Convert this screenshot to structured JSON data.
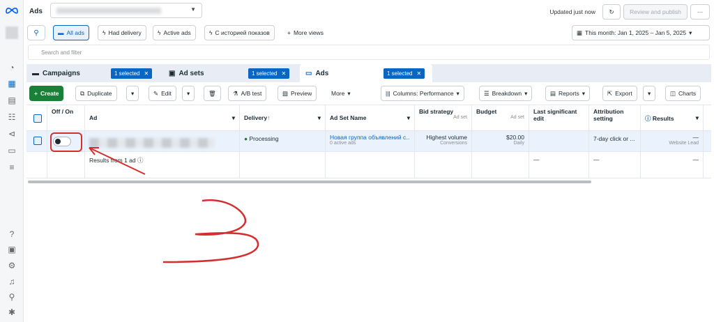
{
  "header": {
    "title": "Ads",
    "updated": "Updated just now",
    "review_label": "Review and publish",
    "more_label": "···"
  },
  "filters": {
    "all_ads": "All ads",
    "had_delivery": "Had delivery",
    "active_ads": "Active ads",
    "impressions_history": "С историей показов",
    "more_views": "More views",
    "date_range": "This month: Jan 1, 2025 – Jan 5, 2025"
  },
  "search": {
    "placeholder": "Search and filter"
  },
  "tabs": {
    "campaigns": "Campaigns",
    "ad_sets": "Ad sets",
    "ads": "Ads",
    "selected": "1 selected"
  },
  "toolbar": {
    "create": "Create",
    "duplicate": "Duplicate",
    "edit": "Edit",
    "ab_test": "A/B test",
    "preview": "Preview",
    "more": "More",
    "columns": "Columns: Performance",
    "breakdown": "Breakdown",
    "reports": "Reports",
    "export": "Export",
    "charts": "Charts"
  },
  "table": {
    "headers": {
      "off_on": "Off / On",
      "ad": "Ad",
      "delivery": "Delivery",
      "ad_set_name": "Ad Set Name",
      "bid_strategy": "Bid strategy",
      "bid_sub": "Ad set",
      "budget": "Budget",
      "budget_sub": "Ad set",
      "last_edit": "Last significant edit",
      "attribution": "Attribution setting",
      "results": "Results"
    },
    "row": {
      "delivery": "Processing",
      "ad_set_name": "Новая группа объявлений с...",
      "ad_set_sub": "0 active ads",
      "bid": "Highest volume",
      "bid_sub": "Conversions",
      "budget": "$20.00",
      "budget_sub": "Daily",
      "attribution": "7-day click or ...",
      "results": "—",
      "results_sub": "Website Lead"
    },
    "summary": {
      "label": "Results from 1 ad",
      "dash": "—"
    }
  },
  "colors": {
    "accent": "#0a66c2",
    "create_green": "#1a7f37",
    "annotation_red": "#d32f2f"
  }
}
